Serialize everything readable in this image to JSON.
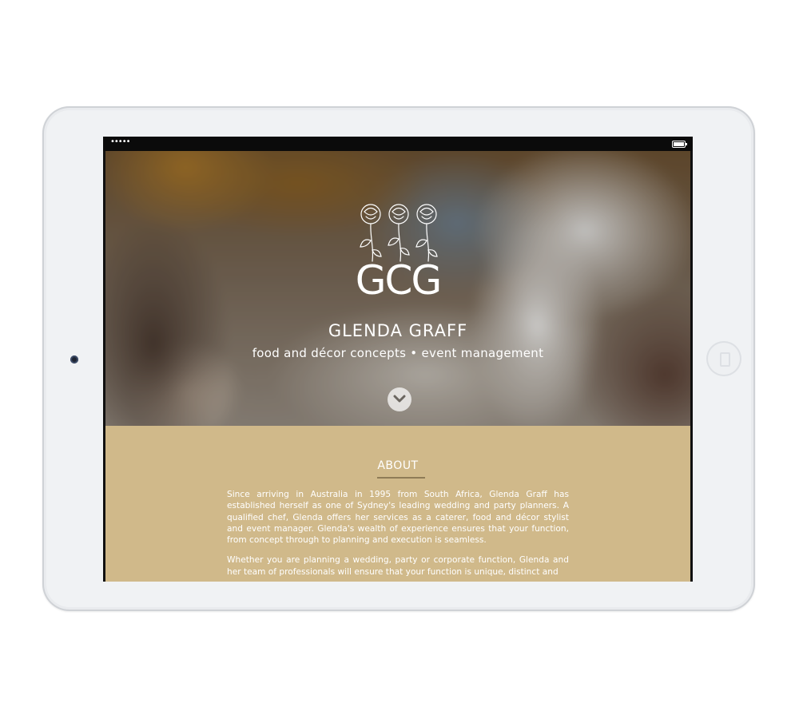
{
  "status_bar": {
    "signal": "•••••",
    "battery_icon": "battery-icon"
  },
  "hero": {
    "logo_icon": "roses-logo-icon",
    "monogram": "GCG",
    "name": "GLENDA GRAFF",
    "tagline": "food and décor concepts • event management",
    "scroll_icon": "chevron-down-icon"
  },
  "about": {
    "heading": "ABOUT",
    "paragraphs": [
      "Since arriving in Australia in 1995 from South Africa, Glenda Graff has established herself as one of Sydney's leading wedding and party planners. A qualified chef, Glenda offers her services as a caterer, food and décor stylist and event manager. Glenda's wealth of experience ensures that your function, from concept through to planning and execution is seamless.",
      "Whether you are planning a wedding, party or corporate function, Glenda and her team of professionals will ensure that your function is unique, distinct and"
    ]
  },
  "colors": {
    "about_background": "#d0b98a",
    "device_frame": "#f0f2f4",
    "text": "#ffffff"
  }
}
